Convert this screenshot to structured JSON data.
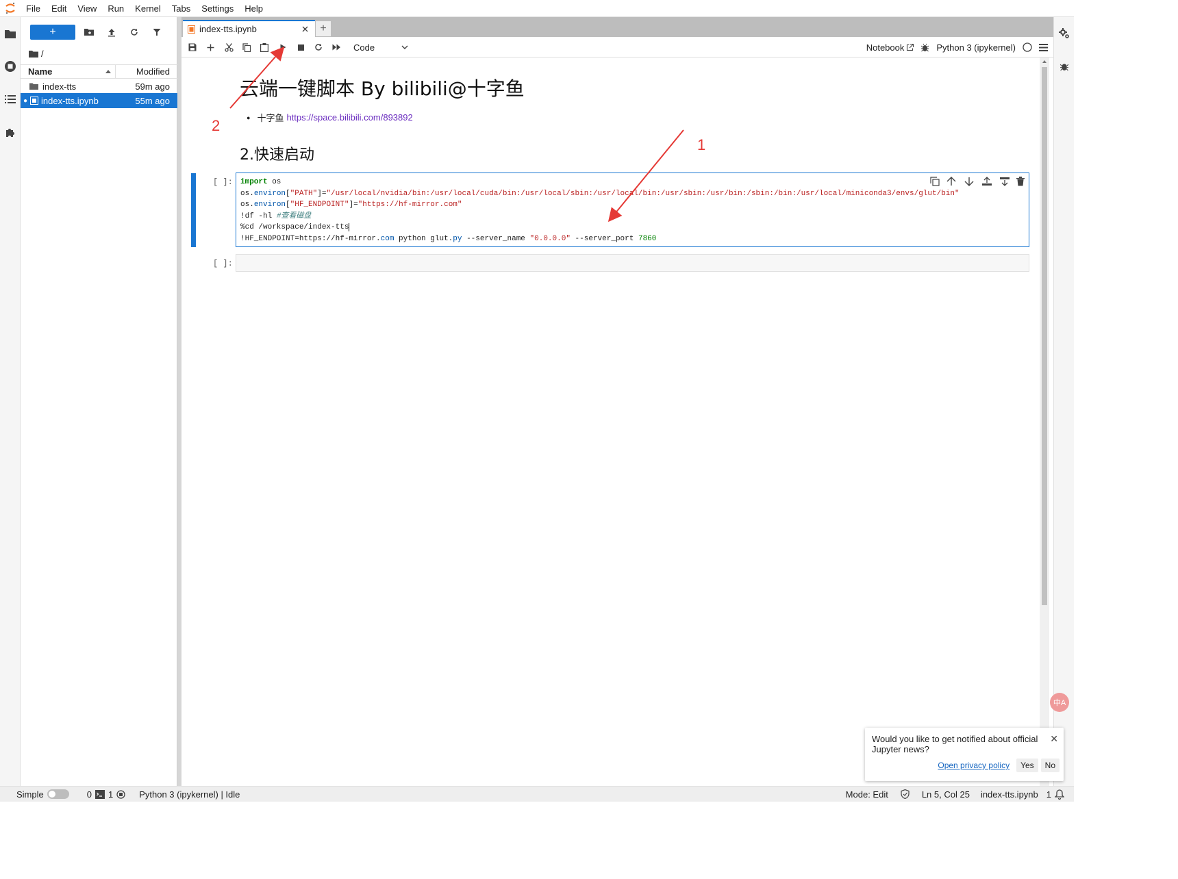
{
  "menubar": {
    "items": [
      "File",
      "Edit",
      "View",
      "Run",
      "Kernel",
      "Tabs",
      "Settings",
      "Help"
    ]
  },
  "filebrowser": {
    "new_label": "+",
    "breadcrumb": "/",
    "header": {
      "name": "Name",
      "modified": "Modified"
    },
    "rows": [
      {
        "name": "index-tts",
        "modified": "59m ago",
        "icon": "folder-icon"
      },
      {
        "name": "index-tts.ipynb",
        "modified": "55m ago",
        "icon": "notebook-icon"
      }
    ]
  },
  "tab": {
    "title": "index-tts.ipynb",
    "add": "+"
  },
  "toolbar": {
    "cell_type": "Code",
    "notebook_label": "Notebook",
    "kernel_label": "Python 3 (ipykernel)"
  },
  "notebook": {
    "h1": "云端一键脚本 By bilibili@十字鱼",
    "bullet_text": "十字鱼",
    "bullet_link": "https://space.bilibili.com/893892",
    "h2": "2.快速启动",
    "prompt1": "[ ]:",
    "prompt2": "[ ]:",
    "code": {
      "l1_kw": "import",
      "l1_rest": " os",
      "l2_a": "os.",
      "l2_b": "environ",
      "l2_c": "[",
      "l2_d": "\"PATH\"",
      "l2_e": "]=",
      "l2_f": "\"/usr/local/nvidia/bin:/usr/local/cuda/bin:/usr/local/sbin:/usr/local/bin:/usr/sbin:/usr/bin:/sbin:/bin:/usr/local/miniconda3/envs/glut/bin\"",
      "l3_a": "os.",
      "l3_b": "environ",
      "l3_c": "[",
      "l3_d": "\"HF_ENDPOINT\"",
      "l3_e": "]=",
      "l3_f": "\"https://hf-mirror.com\"",
      "l4_a": "!df -hl ",
      "l4_b": "#查看磁盘",
      "l5": "%cd /workspace/index-tts",
      "l6_a": "!HF_ENDPOINT=https://hf-mirror.",
      "l6_b": "com",
      "l6_c": " python glut.",
      "l6_d": "py",
      "l6_e": " --server_name ",
      "l6_f": "\"0.0.0.0\"",
      "l6_g": " --server_port ",
      "l6_h": "7860"
    }
  },
  "statusbar": {
    "simple": "Simple",
    "terminals": "0",
    "kernels": "1",
    "kernel_status": "Python 3 (ipykernel) | Idle",
    "mode": "Mode: Edit",
    "position": "Ln 5, Col 25",
    "filename": "index-tts.ipynb",
    "notifications": "1"
  },
  "toast": {
    "message": "Would you like to get notified about official Jupyter news?",
    "privacy": "Open privacy policy",
    "yes": "Yes",
    "no": "No"
  },
  "annotations": {
    "label1": "1",
    "label2": "2"
  },
  "translate_badge": "中A",
  "colors": {
    "accent": "#1976d2",
    "annotation": "#e53935"
  }
}
